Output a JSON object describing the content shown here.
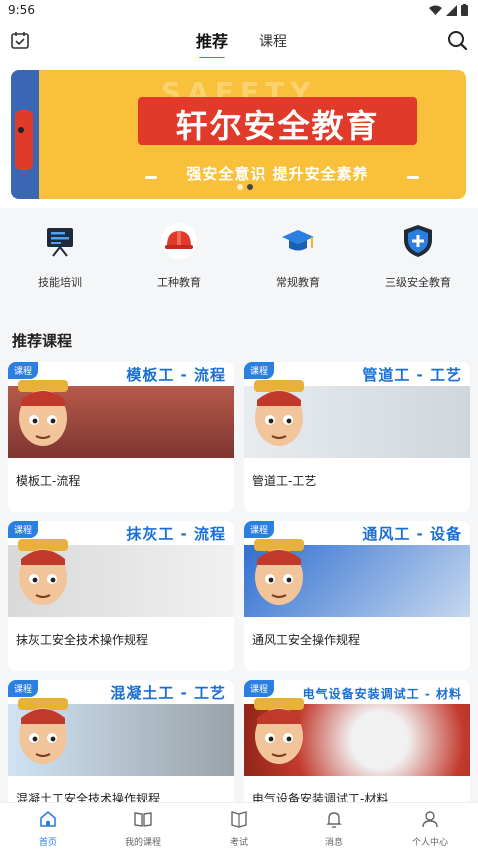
{
  "status": {
    "time": "9:56"
  },
  "header": {
    "tabs": [
      {
        "label": "推荐"
      },
      {
        "label": "课程"
      }
    ]
  },
  "banner": {
    "ghost_text": "SAFETY",
    "title": "轩尔安全教育",
    "subtitle": "强安全意识 提升安全素养"
  },
  "categories": [
    {
      "label": "技能培训",
      "icon": "presentation-board-icon"
    },
    {
      "label": "工种教育",
      "icon": "safety-helmet-icon"
    },
    {
      "label": "常规教育",
      "icon": "graduation-cap-icon"
    },
    {
      "label": "三级安全教育",
      "icon": "shield-plus-icon"
    }
  ],
  "section": {
    "title": "推荐课程"
  },
  "courses": [
    {
      "badge": "课程",
      "headline": "模板工 - 流程",
      "name": "模板工-流程"
    },
    {
      "badge": "课程",
      "headline": "管道工 - 工艺",
      "name": "管道工-工艺"
    },
    {
      "badge": "课程",
      "headline": "抹灰工 - 流程",
      "name": "抹灰工安全技术操作规程"
    },
    {
      "badge": "课程",
      "headline": "通风工 - 设备",
      "name": "通风工安全操作规程"
    },
    {
      "badge": "课程",
      "headline": "混凝土工 - 工艺",
      "name": "混凝土工安全技术操作规程"
    },
    {
      "badge": "课程",
      "headline": "电气设备安装调试工 - 材料",
      "name": "电气设备安装调试工-材料"
    }
  ],
  "tabbar": [
    {
      "label": "首页",
      "active": true
    },
    {
      "label": "我的课程"
    },
    {
      "label": "考试"
    },
    {
      "label": "消息"
    },
    {
      "label": "个人中心"
    }
  ],
  "colors": {
    "accent": "#2b7fe0",
    "banner": "#f9c13b",
    "banner_red": "#e03a2a"
  }
}
